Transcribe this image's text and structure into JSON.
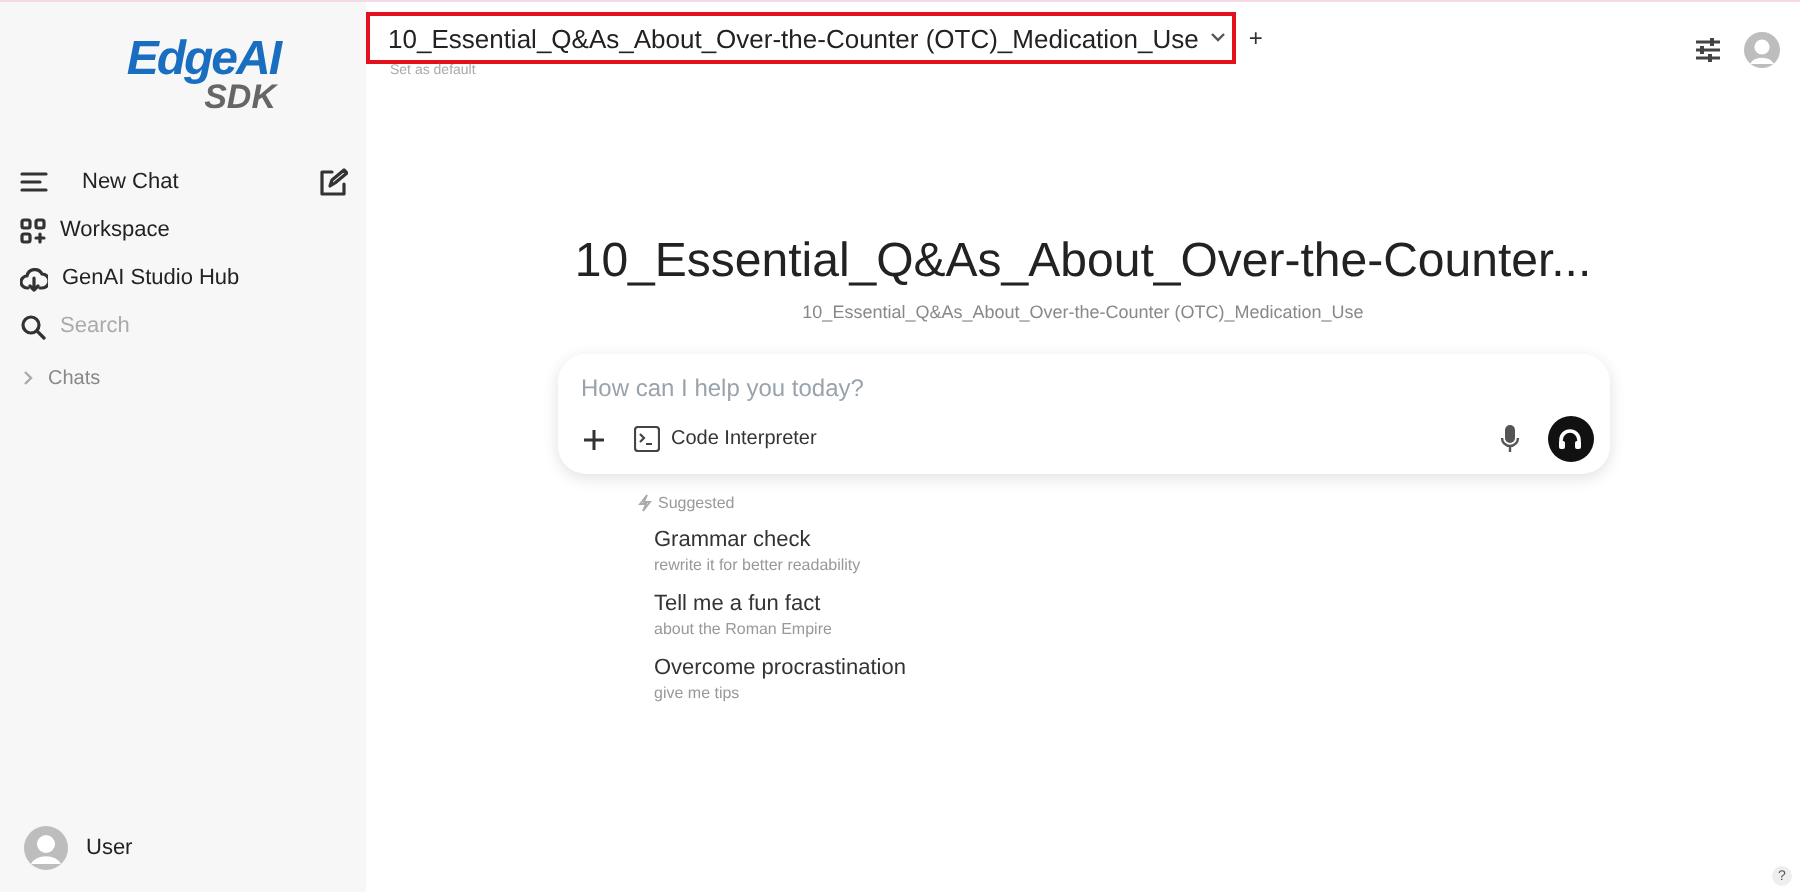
{
  "logo": {
    "main": "EdgeAI",
    "sub": "SDK"
  },
  "sidebar": {
    "items": [
      {
        "kind": "new",
        "label": "New Chat"
      },
      {
        "kind": "workspace",
        "label": "Workspace"
      },
      {
        "kind": "hub",
        "label": "GenAI Studio Hub"
      },
      {
        "kind": "search",
        "placeholder": "Search"
      }
    ],
    "section": {
      "label": "Chats",
      "expanded": false
    },
    "user": {
      "name": "User"
    }
  },
  "model_selector": {
    "value": "10_Essential_Q&As_About_Over-the-Counter (OTC)_Medication_Use",
    "highlighted": true,
    "add": "+",
    "hint": "Set as default"
  },
  "heading": {
    "title": "10_Essential_Q&As_About_Over-the-Counter...",
    "subtitle": "10_Essential_Q&As_About_Over-the-Counter (OTC)_Medication_Use"
  },
  "prompt": {
    "placeholder": "How can I help you today?",
    "tool": "Code Interpreter"
  },
  "suggested": {
    "label": "Suggested",
    "items": [
      {
        "title": "Grammar check",
        "subtitle": "rewrite it for better readability"
      },
      {
        "title": "Tell me a fun fact",
        "subtitle": "about the Roman Empire"
      },
      {
        "title": "Overcome procrastination",
        "subtitle": "give me tips"
      }
    ]
  },
  "help": "?"
}
